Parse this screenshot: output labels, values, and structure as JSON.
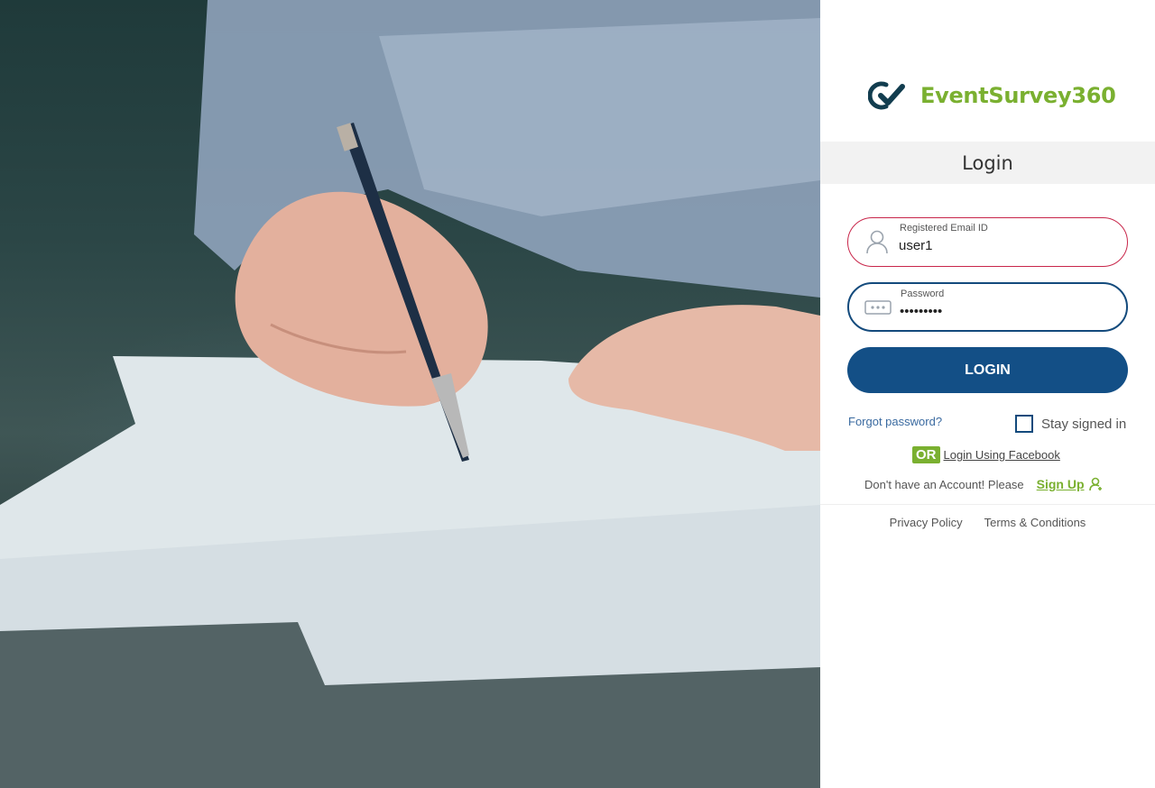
{
  "brand": {
    "name_part1": "EventSur",
    "name_part2": "ey360",
    "name_full": "EventSurvey360",
    "logo_icon": "checkmark-logo-icon",
    "accent_color": "#7ab030",
    "primary_color": "#134f86"
  },
  "header": {
    "title": "Login"
  },
  "form": {
    "email": {
      "label": "Registered Email ID",
      "value": "user1",
      "icon": "user-icon"
    },
    "password": {
      "label": "Password",
      "value": "•••••••••",
      "icon": "password-dots-icon"
    },
    "login_button": "LOGIN",
    "forgot_password": "Forgot password?",
    "stay_signed_in": {
      "label": "Stay signed in",
      "checked": false
    }
  },
  "social": {
    "or_badge": "OR",
    "facebook_link": "Login Using Facebook"
  },
  "signup": {
    "prompt": "Don't have an Account! Please",
    "link": "Sign Up",
    "icon": "add-user-icon"
  },
  "footer": {
    "privacy": "Privacy Policy",
    "terms": "Terms & Conditions"
  }
}
